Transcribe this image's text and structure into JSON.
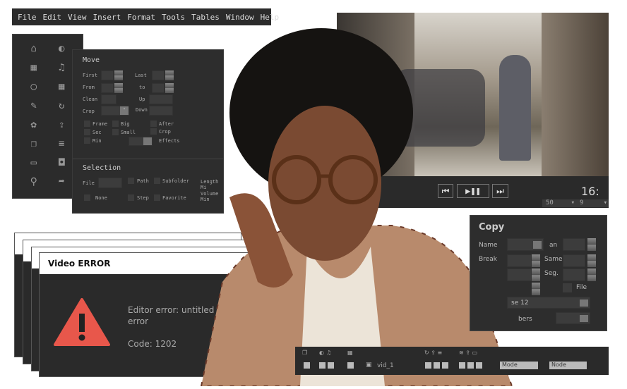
{
  "menubar": {
    "items": [
      "File",
      "Edit",
      "View",
      "Insert",
      "Format",
      "Tools",
      "Tables",
      "Window",
      "Help"
    ]
  },
  "sidebar": {
    "icons": [
      "home-icon",
      "shield-icon",
      "grid-icon",
      "bell-icon",
      "refresh-icon",
      "apps-icon",
      "pencil-icon",
      "undo-icon",
      "gear-icon",
      "share-icon",
      "copy-icon",
      "add-list-icon",
      "monitor-icon",
      "toggle-icon",
      "search-icon",
      "forward-icon"
    ]
  },
  "move": {
    "title": "Move",
    "first": "First",
    "last": "Last",
    "from": "From",
    "to": "to",
    "clean": "Clean",
    "up": "Up",
    "crop": "Crop",
    "down": "Down",
    "checks": [
      "Frame",
      "Big",
      "After",
      "Sec",
      "Small",
      "Crop",
      "Min"
    ],
    "effects": "Effects",
    "selection": "Selection",
    "file": "File",
    "path": "Path",
    "subfolder": "Subfolder",
    "none": "None",
    "step": "Step",
    "favorite": "Favorite",
    "length": "Length Mi",
    "volume": "Volume Min"
  },
  "player": {
    "aspect": "16:",
    "sel1": "50",
    "sel2": "9"
  },
  "copy": {
    "title": "Copy",
    "name": "Name",
    "an": "an",
    "break": "Break",
    "same": "Same",
    "seg": "Seg.",
    "file": "File",
    "dropdown1": "se 12",
    "dropdown2": "bers"
  },
  "error": {
    "title": "Video ERROR",
    "message": "Editor error: untitled error",
    "code": "Code: 1202"
  },
  "toolbar": {
    "file": "vid_1",
    "mode": "Mode",
    "node": "Node"
  }
}
